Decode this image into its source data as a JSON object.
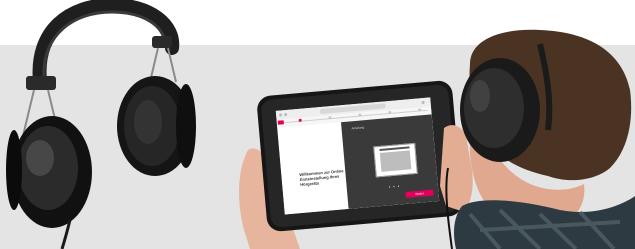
{
  "brand": {
    "accent": "#e2005a",
    "backdrop": "#e4e4e4"
  },
  "tablet": {
    "browser": {
      "url_text": ""
    },
    "progress_steps": [
      {
        "label": ""
      },
      {
        "label": ""
      },
      {
        "label": ""
      },
      {
        "label": ""
      },
      {
        "label": ""
      }
    ],
    "active_step": 1,
    "welcome_text": "Willkommen zur Online Ersteinstellung Ihres Hörgeräts",
    "panel": {
      "heading": "Anleitung",
      "subheading": "",
      "pager_dots": "• • •",
      "back_label": "",
      "next_label": "Weiter"
    }
  },
  "icons": [
    "headphones-icon"
  ]
}
